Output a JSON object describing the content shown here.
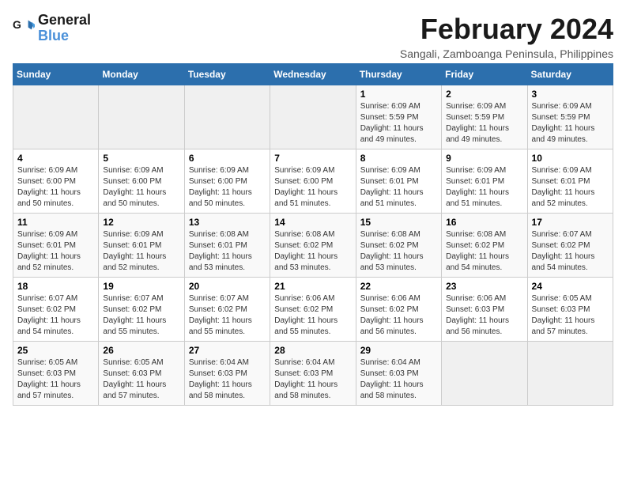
{
  "logo": {
    "text_general": "General",
    "text_blue": "Blue"
  },
  "title": {
    "month_year": "February 2024",
    "subtitle": "Sangali, Zamboanga Peninsula, Philippines"
  },
  "days_of_week": [
    "Sunday",
    "Monday",
    "Tuesday",
    "Wednesday",
    "Thursday",
    "Friday",
    "Saturday"
  ],
  "weeks": [
    [
      {
        "day": "",
        "info": ""
      },
      {
        "day": "",
        "info": ""
      },
      {
        "day": "",
        "info": ""
      },
      {
        "day": "",
        "info": ""
      },
      {
        "day": "1",
        "info": "Sunrise: 6:09 AM\nSunset: 5:59 PM\nDaylight: 11 hours and 49 minutes."
      },
      {
        "day": "2",
        "info": "Sunrise: 6:09 AM\nSunset: 5:59 PM\nDaylight: 11 hours and 49 minutes."
      },
      {
        "day": "3",
        "info": "Sunrise: 6:09 AM\nSunset: 5:59 PM\nDaylight: 11 hours and 49 minutes."
      }
    ],
    [
      {
        "day": "4",
        "info": "Sunrise: 6:09 AM\nSunset: 6:00 PM\nDaylight: 11 hours and 50 minutes."
      },
      {
        "day": "5",
        "info": "Sunrise: 6:09 AM\nSunset: 6:00 PM\nDaylight: 11 hours and 50 minutes."
      },
      {
        "day": "6",
        "info": "Sunrise: 6:09 AM\nSunset: 6:00 PM\nDaylight: 11 hours and 50 minutes."
      },
      {
        "day": "7",
        "info": "Sunrise: 6:09 AM\nSunset: 6:00 PM\nDaylight: 11 hours and 51 minutes."
      },
      {
        "day": "8",
        "info": "Sunrise: 6:09 AM\nSunset: 6:01 PM\nDaylight: 11 hours and 51 minutes."
      },
      {
        "day": "9",
        "info": "Sunrise: 6:09 AM\nSunset: 6:01 PM\nDaylight: 11 hours and 51 minutes."
      },
      {
        "day": "10",
        "info": "Sunrise: 6:09 AM\nSunset: 6:01 PM\nDaylight: 11 hours and 52 minutes."
      }
    ],
    [
      {
        "day": "11",
        "info": "Sunrise: 6:09 AM\nSunset: 6:01 PM\nDaylight: 11 hours and 52 minutes."
      },
      {
        "day": "12",
        "info": "Sunrise: 6:09 AM\nSunset: 6:01 PM\nDaylight: 11 hours and 52 minutes."
      },
      {
        "day": "13",
        "info": "Sunrise: 6:08 AM\nSunset: 6:01 PM\nDaylight: 11 hours and 53 minutes."
      },
      {
        "day": "14",
        "info": "Sunrise: 6:08 AM\nSunset: 6:02 PM\nDaylight: 11 hours and 53 minutes."
      },
      {
        "day": "15",
        "info": "Sunrise: 6:08 AM\nSunset: 6:02 PM\nDaylight: 11 hours and 53 minutes."
      },
      {
        "day": "16",
        "info": "Sunrise: 6:08 AM\nSunset: 6:02 PM\nDaylight: 11 hours and 54 minutes."
      },
      {
        "day": "17",
        "info": "Sunrise: 6:07 AM\nSunset: 6:02 PM\nDaylight: 11 hours and 54 minutes."
      }
    ],
    [
      {
        "day": "18",
        "info": "Sunrise: 6:07 AM\nSunset: 6:02 PM\nDaylight: 11 hours and 54 minutes."
      },
      {
        "day": "19",
        "info": "Sunrise: 6:07 AM\nSunset: 6:02 PM\nDaylight: 11 hours and 55 minutes."
      },
      {
        "day": "20",
        "info": "Sunrise: 6:07 AM\nSunset: 6:02 PM\nDaylight: 11 hours and 55 minutes."
      },
      {
        "day": "21",
        "info": "Sunrise: 6:06 AM\nSunset: 6:02 PM\nDaylight: 11 hours and 55 minutes."
      },
      {
        "day": "22",
        "info": "Sunrise: 6:06 AM\nSunset: 6:02 PM\nDaylight: 11 hours and 56 minutes."
      },
      {
        "day": "23",
        "info": "Sunrise: 6:06 AM\nSunset: 6:03 PM\nDaylight: 11 hours and 56 minutes."
      },
      {
        "day": "24",
        "info": "Sunrise: 6:05 AM\nSunset: 6:03 PM\nDaylight: 11 hours and 57 minutes."
      }
    ],
    [
      {
        "day": "25",
        "info": "Sunrise: 6:05 AM\nSunset: 6:03 PM\nDaylight: 11 hours and 57 minutes."
      },
      {
        "day": "26",
        "info": "Sunrise: 6:05 AM\nSunset: 6:03 PM\nDaylight: 11 hours and 57 minutes."
      },
      {
        "day": "27",
        "info": "Sunrise: 6:04 AM\nSunset: 6:03 PM\nDaylight: 11 hours and 58 minutes."
      },
      {
        "day": "28",
        "info": "Sunrise: 6:04 AM\nSunset: 6:03 PM\nDaylight: 11 hours and 58 minutes."
      },
      {
        "day": "29",
        "info": "Sunrise: 6:04 AM\nSunset: 6:03 PM\nDaylight: 11 hours and 58 minutes."
      },
      {
        "day": "",
        "info": ""
      },
      {
        "day": "",
        "info": ""
      }
    ]
  ]
}
